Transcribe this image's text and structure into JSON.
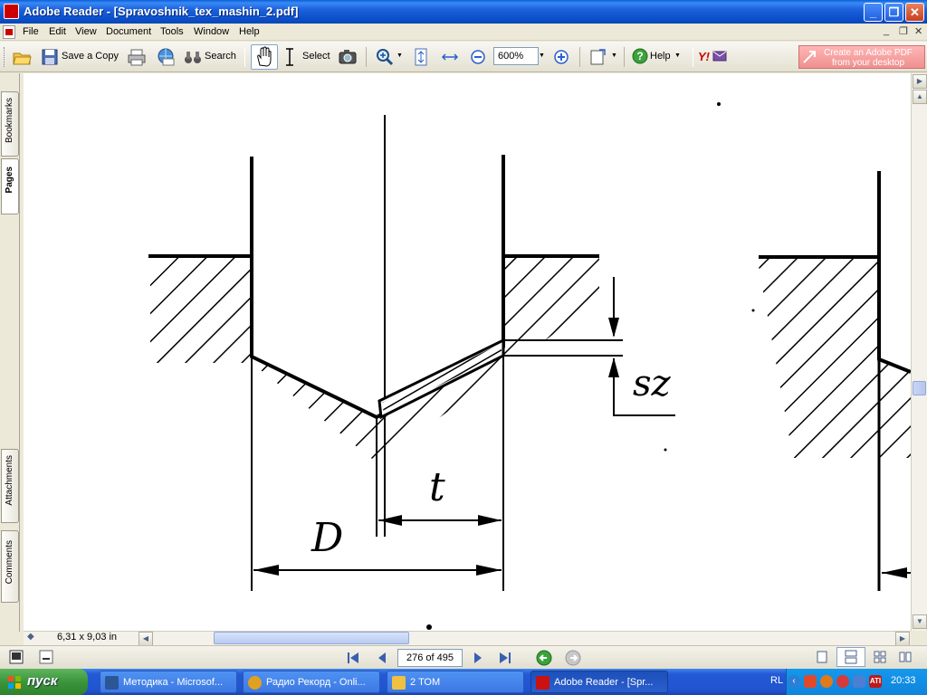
{
  "window": {
    "title": "Adobe Reader - [Spravoshnik_tex_mashin_2.pdf]",
    "minimize": "_",
    "restore": "❐",
    "close": "✕"
  },
  "menu": {
    "items": [
      "File",
      "Edit",
      "View",
      "Document",
      "Tools",
      "Window",
      "Help"
    ],
    "doc_controls": [
      "_",
      "❐",
      "✕"
    ]
  },
  "toolbar": {
    "save_copy_label": "Save a Copy",
    "search_label": "Search",
    "select_label": "Select",
    "zoom_value": "600%",
    "help_label": "Help",
    "yahoo_label": "Y!",
    "create_pdf_label_1": "Create an Adobe PDF",
    "create_pdf_label_2": "from your desktop"
  },
  "navpanel": {
    "tabs": [
      "Bookmarks",
      "Pages",
      "Attachments",
      "Comments"
    ]
  },
  "document": {
    "labels": {
      "t": "t",
      "D": "D",
      "sz": "sz"
    }
  },
  "hscroll": {
    "page_size": "6,31 x 9,03 in"
  },
  "statusbar": {
    "page_indicator": "276 of 495"
  },
  "taskbar": {
    "start_label": "пуск",
    "tasks": [
      {
        "label": "Методика - Microsof...",
        "color": "#2b5797"
      },
      {
        "label": "Радио Рекорд - Onli...",
        "color": "#e0a020"
      },
      {
        "label": "2 ТОМ",
        "color": "#f0c040"
      },
      {
        "label": "Adobe Reader - [Spr...",
        "color": "#cc1111"
      }
    ],
    "language": "RL",
    "clock": "20:33"
  },
  "colors": {
    "accent": "#0a46b8",
    "adobe_red": "#cc1111",
    "start_green": "#3c943b"
  }
}
